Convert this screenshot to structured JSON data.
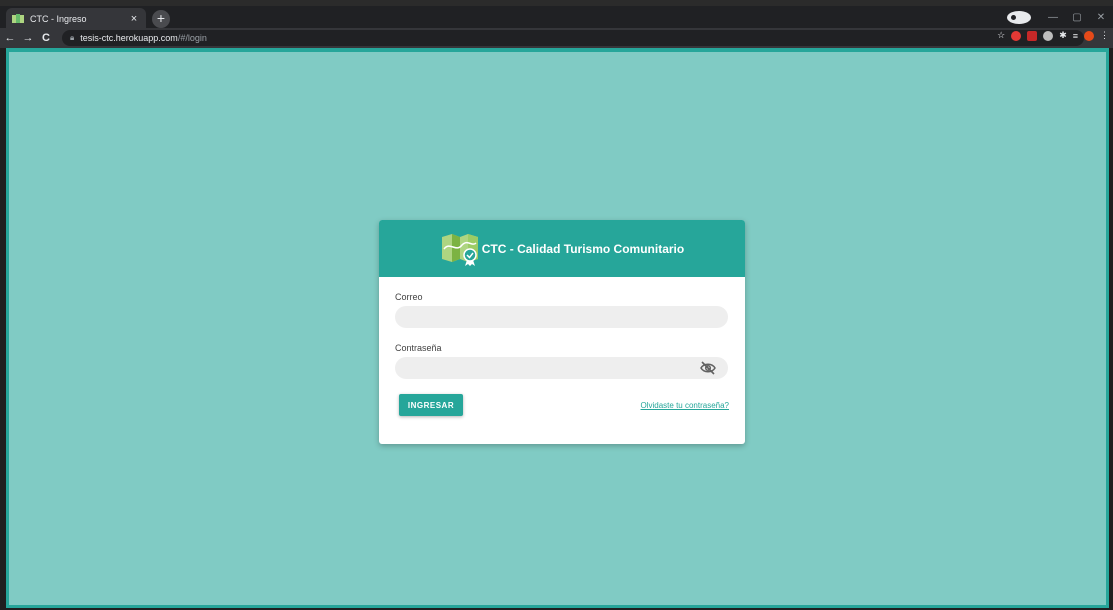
{
  "browser": {
    "tab_title": "CTC - Ingreso",
    "tab_close": "×",
    "new_tab": "+",
    "url_host": "tesis-ctc.herokuapp.com",
    "url_path": "/#/login",
    "nav_back": "←",
    "nav_forward": "→",
    "nav_reload": "C",
    "icons": [
      "favicon-map-icon",
      "back-icon",
      "forward-icon",
      "reload-icon",
      "lock-icon",
      "star-icon",
      "extensions-icon",
      "profile-icon"
    ]
  },
  "login": {
    "title": "CTC - Calidad Turismo Comunitario",
    "email_label": "Correo",
    "email_value": "",
    "password_label": "Contraseña",
    "password_value": "",
    "submit_label": "INGRESAR",
    "forgot_label": "Olvidaste tu contraseña?"
  },
  "colors": {
    "accent": "#26a69a",
    "background": "#80cbc4",
    "field": "#eeeeee"
  }
}
